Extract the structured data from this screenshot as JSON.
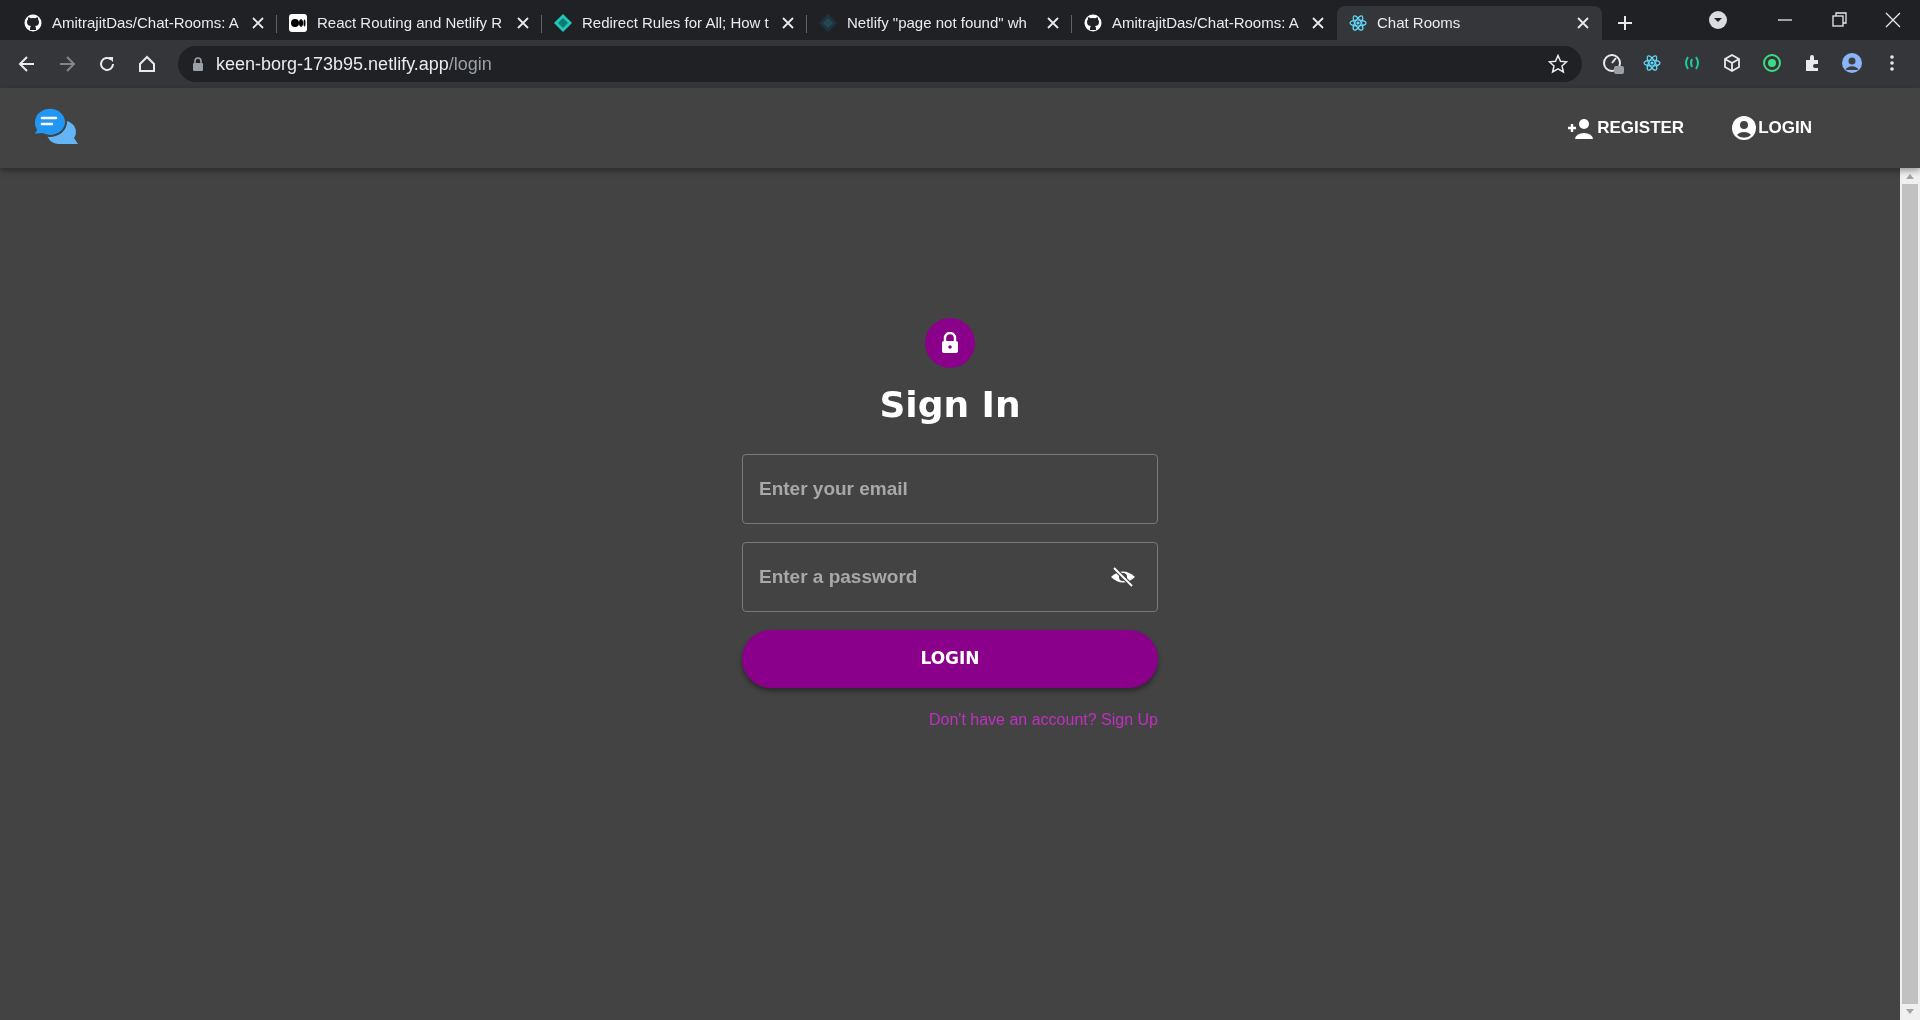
{
  "browser": {
    "tabs": [
      {
        "title": "AmitrajitDas/Chat-Rooms: A",
        "kind": "github",
        "selected": false
      },
      {
        "title": "React Routing and Netlify R",
        "kind": "medium",
        "selected": false
      },
      {
        "title": "Redirect Rules for All; How t",
        "kind": "netlify",
        "selected": false
      },
      {
        "title": "Netlify \"page not found\" wh",
        "kind": "netlifydark",
        "selected": false
      },
      {
        "title": "AmitrajitDas/Chat-Rooms: A",
        "kind": "github",
        "selected": false
      },
      {
        "title": "Chat Rooms",
        "kind": "react",
        "selected": true
      }
    ],
    "address": {
      "host": "keen-borg-173b95.netlify.app",
      "path": "/login"
    }
  },
  "header": {
    "nav": [
      {
        "label": "REGISTER",
        "kind": "register"
      },
      {
        "label": "LOGIN",
        "kind": "login"
      }
    ]
  },
  "form": {
    "title": "Sign In",
    "fields": [
      {
        "kind": "email",
        "placeholder": "Enter your email"
      },
      {
        "kind": "password",
        "placeholder": "Enter a password",
        "visible": false
      }
    ],
    "submit": "LOGIN",
    "link": "Don't have an account? Sign Up"
  }
}
